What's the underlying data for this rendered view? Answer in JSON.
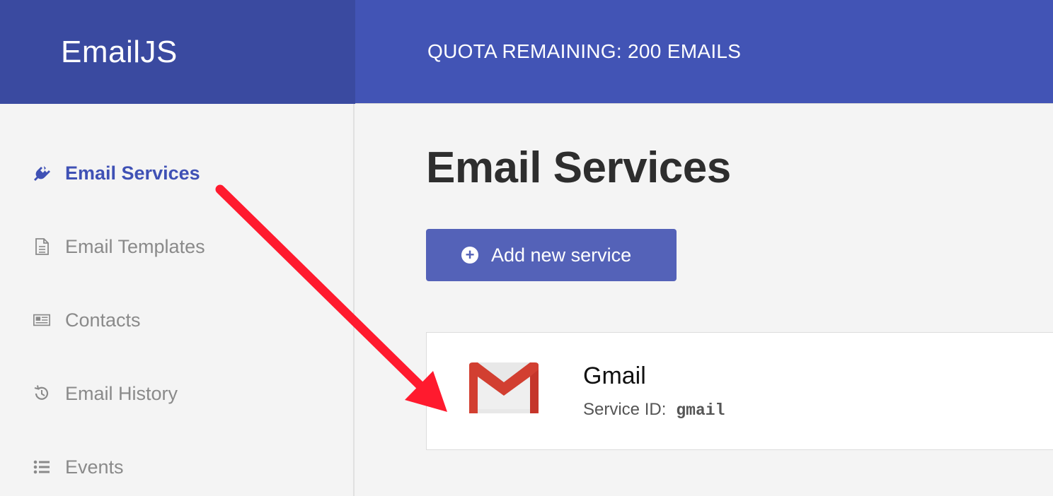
{
  "app": {
    "brand": "EmailJS"
  },
  "header": {
    "quota_text": "QUOTA REMAINING: 200 EMAILS"
  },
  "sidebar": {
    "items": [
      {
        "label": "Email Services",
        "icon": "plug-icon",
        "active": true
      },
      {
        "label": "Email Templates",
        "icon": "document-icon",
        "active": false
      },
      {
        "label": "Contacts",
        "icon": "contacts-icon",
        "active": false
      },
      {
        "label": "Email History",
        "icon": "history-icon",
        "active": false
      },
      {
        "label": "Events",
        "icon": "list-icon",
        "active": false
      }
    ]
  },
  "main": {
    "title": "Email Services",
    "add_button_label": "Add new service",
    "services": [
      {
        "name": "Gmail",
        "id_label": "Service ID:",
        "id_value": "gmail",
        "icon": "gmail-icon"
      }
    ]
  },
  "colors": {
    "brand_dark": "#3a4aa0",
    "brand": "#4254b5",
    "button": "#5462b8",
    "active_nav": "#3f51b5",
    "annotation_arrow": "#ff1a2e"
  }
}
